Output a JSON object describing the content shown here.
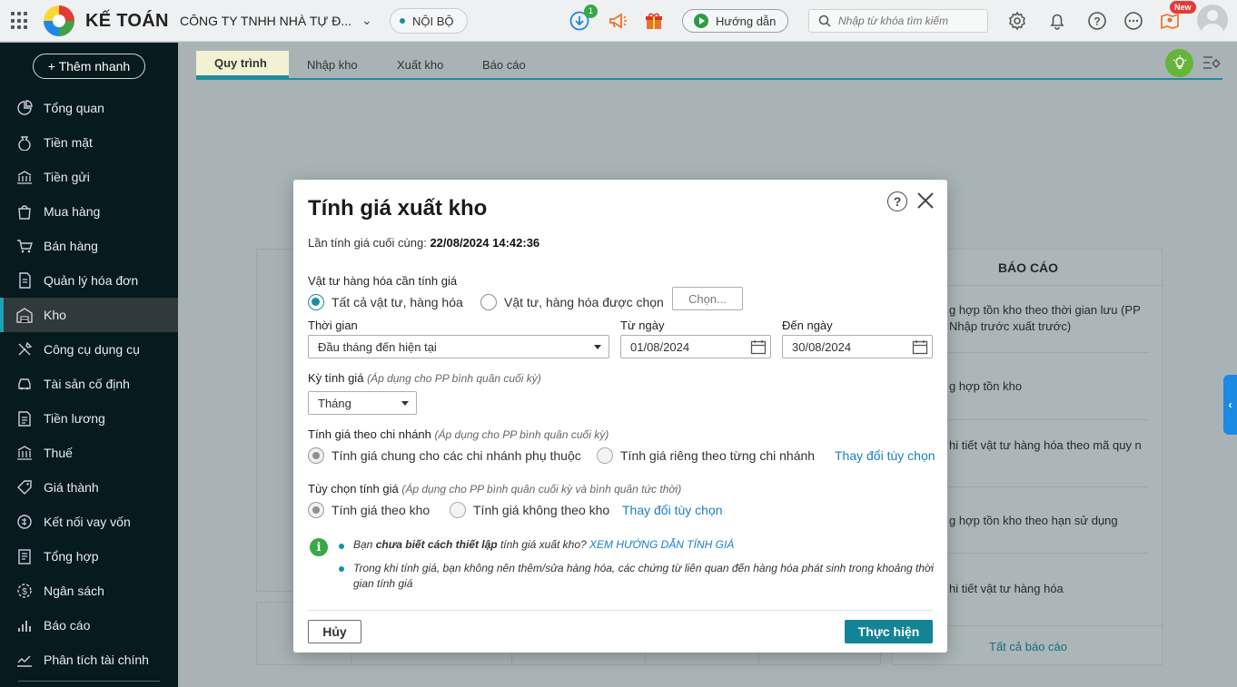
{
  "topbar": {
    "app_name": "KẾ TOÁN",
    "company": "CÔNG TY TNHH NHÀ TỰ Đ...",
    "scope": "NỘI BỘ",
    "download_badge": "1",
    "guide_label": "Hướng dẫn",
    "search_placeholder": "Nhập từ khóa tìm kiếm",
    "new_badge": "New"
  },
  "sidebar": {
    "quick_add": "+ Thêm nhanh",
    "items": [
      {
        "label": "Tổng quan",
        "icon": "pie-chart-icon"
      },
      {
        "label": "Tiền mặt",
        "icon": "money-bag-icon"
      },
      {
        "label": "Tiền gửi",
        "icon": "bank-icon"
      },
      {
        "label": "Mua hàng",
        "icon": "shopping-bag-icon"
      },
      {
        "label": "Bán hàng",
        "icon": "cart-icon"
      },
      {
        "label": "Quản lý hóa đơn",
        "icon": "invoice-icon"
      },
      {
        "label": "Kho",
        "icon": "warehouse-icon",
        "active": true
      },
      {
        "label": "Công cụ dụng cụ",
        "icon": "tools-icon"
      },
      {
        "label": "Tài sản cố định",
        "icon": "car-icon"
      },
      {
        "label": "Tiền lương",
        "icon": "payroll-icon"
      },
      {
        "label": "Thuế",
        "icon": "tax-icon"
      },
      {
        "label": "Giá thành",
        "icon": "price-tag-icon"
      },
      {
        "label": "Kết nối vay vốn",
        "icon": "loan-icon"
      },
      {
        "label": "Tổng hợp",
        "icon": "summary-icon"
      },
      {
        "label": "Ngân sách",
        "icon": "budget-icon"
      },
      {
        "label": "Báo cáo",
        "icon": "bar-chart-icon"
      },
      {
        "label": "Phân tích tài chính",
        "icon": "analysis-icon"
      }
    ]
  },
  "tabs": [
    "Quy trình",
    "Nhập kho",
    "Xuất kho",
    "Báo cáo"
  ],
  "report_panel": {
    "title": "BÁO CÁO",
    "items": [
      "g hợp tồn kho theo thời gian lưu (PP Nhập trước xuất trước)",
      "g hợp tồn kho",
      "hi tiết vật tư hàng hóa theo mã quy n",
      "g hợp tồn kho theo hạn sử dụng",
      "hi tiết vật tư hàng hóa"
    ],
    "all_link": "Tất cả báo cáo"
  },
  "dialog": {
    "title": "Tính giá xuất kho",
    "last_calc_label": "Lần tính giá cuối cùng: ",
    "last_calc_value": "22/08/2024 14:42:36",
    "items_section": {
      "label": "Vật tư hàng hóa cần tính giá",
      "option_all": "Tất cả vật tư, hàng hóa",
      "option_selected": "Vật tư, hàng hóa được chọn",
      "choose_button": "Chọn..."
    },
    "time": {
      "label": "Thời gian",
      "value": "Đầu tháng đến hiện tại",
      "from_label": "Từ ngày",
      "from_value": "01/08/2024",
      "to_label": "Đến ngày",
      "to_value": "30/08/2024"
    },
    "period": {
      "label": "Kỳ tính giá",
      "hint": "(Áp dụng cho PP bình quân cuối kỳ)",
      "value": "Tháng"
    },
    "branch": {
      "label": "Tính giá theo chi nhánh",
      "hint": "(Áp dụng cho PP bình quân cuối kỳ)",
      "option_common": "Tính giá chung cho các chi nhánh phụ thuộc",
      "option_separate": "Tính giá riêng theo từng chi nhánh",
      "change_link": "Thay đổi tùy chọn"
    },
    "options": {
      "label": "Tùy chọn tính giá",
      "hint": "(Áp dụng cho PP bình quân cuối kỳ và bình quân tức thời)",
      "option_by_warehouse": "Tính giá theo kho",
      "option_not_by_warehouse": "Tính giá không theo kho",
      "change_link": "Thay đổi tùy chọn"
    },
    "notes": {
      "note1_prefix": "Bạn ",
      "note1_bold": "chưa biết cách thiết lập",
      "note1_middle": " tính giá xuất kho? ",
      "note1_link": "XEM HƯỚNG DẪN TÍNH GIÁ",
      "note2": "Trong khi tính giá, bạn không nên thêm/sửa hàng hóa, các chứng từ liên quan đến hàng hóa phát sinh trong khoảng thời gian tính giá"
    },
    "cancel_button": "Hủy",
    "run_button": "Thực hiện"
  },
  "colors": {
    "accent": "#138496",
    "link": "#1a7fc6",
    "sidebar_bg": "#071a1d"
  }
}
